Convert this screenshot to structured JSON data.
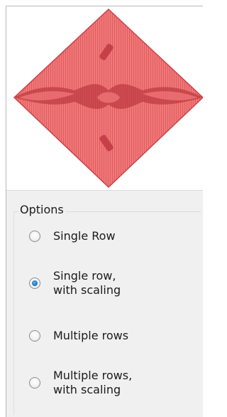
{
  "preview": {
    "shape": "red-diamond-embroidery-preview",
    "colors": {
      "fill": "#e8595b",
      "stitch": "#f08f8f",
      "shadow": "#b8323a"
    }
  },
  "options": {
    "title": "Options",
    "selected": "Single row, with scaling",
    "items": [
      {
        "label": "Single Row",
        "checked": false
      },
      {
        "label": "Single row,\nwith scaling",
        "checked": true
      },
      {
        "label": "Multiple rows",
        "checked": false
      },
      {
        "label": "Multiple rows,\nwith scaling",
        "checked": false
      }
    ]
  },
  "colors": {
    "panel_bg": "#f0f0f0",
    "radio_selected": "#1f74c2",
    "border": "#b9b9b9"
  }
}
